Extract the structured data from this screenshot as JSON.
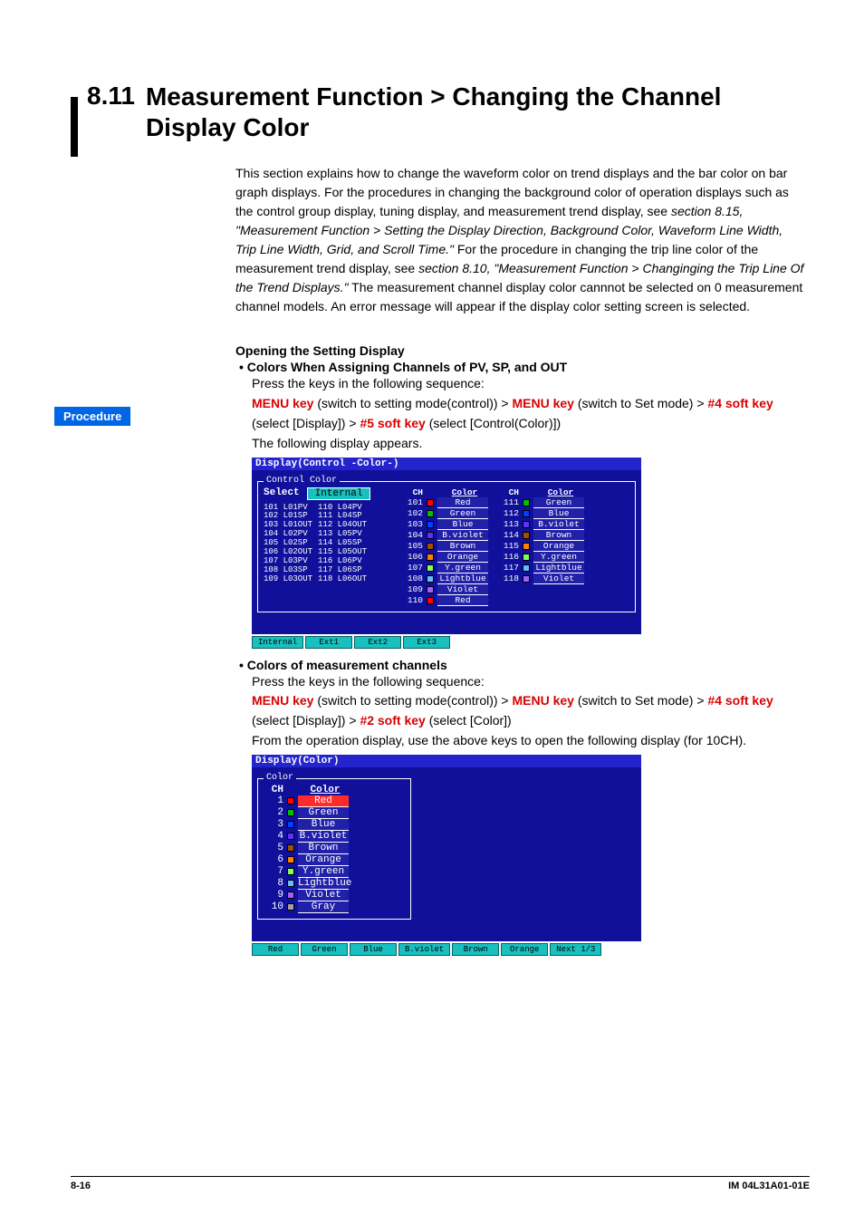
{
  "section_number": "8.11",
  "section_title": "Measurement Function > Changing the Channel Display Color",
  "intro_1": "This section explains how to change the waveform color on trend displays and the bar color on bar graph displays.  For the procedures in changing the background color of operation displays such as the control group display, tuning display, and measurement trend display, see ",
  "intro_ref1": "section 8.15, \"Measurement Function > Setting the Display Direction, Background Color, Waveform Line Width, Trip Line Width, Grid, and Scroll Time.\"",
  "intro_2": "  For the procedure in changing the trip line color of the measurement trend display, see ",
  "intro_ref2": "section 8.10, \"Measurement Function > Changinging the Trip Line Of the Trend Displays.\"",
  "intro_3": "  The measurement channel display color cannnot be selected on 0 measurement channel models.  An error message will appear if the display color setting screen is selected.",
  "procedure_label": "Procedure",
  "open_heading": "Opening the Setting Display",
  "bullet1_title": "Colors When Assigning Channels of PV, SP, and OUT",
  "press_line": "Press the keys in the following sequence:",
  "menu_key": "MENU key",
  "k4": "#4 soft key",
  "k5": "#5 soft key",
  "k2": "#2 soft key",
  "seq1_a": " (switch to setting mode(control)) > ",
  "seq1_b": " (switch to Set mode) > ",
  "seq1_c": " (select [Display]) > ",
  "seq1_d": " (select [Control(Color)])",
  "following_display": "The following display appears.",
  "scr1_title": "Display(Control -Color-)",
  "scr1_group": "Control Color",
  "scr1_select_label": "Select",
  "scr1_select_value": "Internal",
  "scr1_left_list": [
    "101 L01PV",
    "102 L01SP",
    "103 L01OUT",
    "104 L02PV",
    "105 L02SP",
    "106 L02OUT",
    "107 L03PV",
    "108 L03SP",
    "109 L03OUT"
  ],
  "scr1_right_list": [
    "110 L04PV",
    "111 L04SP",
    "112 L04OUT",
    "113 L05PV",
    "114 L05SP",
    "115 L05OUT",
    "116 L06PV",
    "117 L06SP",
    "118 L06OUT"
  ],
  "ch_header": "CH",
  "color_header": "Color",
  "scr1_colA": [
    {
      "ch": "101",
      "sw": "#ff0000",
      "name": "Red"
    },
    {
      "ch": "102",
      "sw": "#00c000",
      "name": "Green"
    },
    {
      "ch": "103",
      "sw": "#0040ff",
      "name": "Blue"
    },
    {
      "ch": "104",
      "sw": "#6030ff",
      "name": "B.violet"
    },
    {
      "ch": "105",
      "sw": "#a05000",
      "name": "Brown"
    },
    {
      "ch": "106",
      "sw": "#ff8000",
      "name": "Orange"
    },
    {
      "ch": "107",
      "sw": "#80ff60",
      "name": "Y.green"
    },
    {
      "ch": "108",
      "sw": "#60c0ff",
      "name": "Lightblue"
    },
    {
      "ch": "109",
      "sw": "#a060ff",
      "name": "Violet"
    },
    {
      "ch": "110",
      "sw": "#ff0000",
      "name": "Red"
    }
  ],
  "scr1_colB": [
    {
      "ch": "111",
      "sw": "#00c000",
      "name": "Green"
    },
    {
      "ch": "112",
      "sw": "#0040ff",
      "name": "Blue"
    },
    {
      "ch": "113",
      "sw": "#6030ff",
      "name": "B.violet"
    },
    {
      "ch": "114",
      "sw": "#a05000",
      "name": "Brown"
    },
    {
      "ch": "115",
      "sw": "#ff8000",
      "name": "Orange"
    },
    {
      "ch": "116",
      "sw": "#80ff60",
      "name": "Y.green"
    },
    {
      "ch": "117",
      "sw": "#60c0ff",
      "name": "Lightblue"
    },
    {
      "ch": "118",
      "sw": "#a060ff",
      "name": "Violet"
    }
  ],
  "scr1_softkeys": [
    "Internal",
    "Ext1",
    "Ext2",
    "Ext3"
  ],
  "bullet2_title": "Colors of measurement channels",
  "seq2_d": " (select [Color])",
  "from_op_line": "From the operation display, use the above keys to open the following display (for 10CH).",
  "scr2_title": "Display(Color)",
  "scr2_group": "Color",
  "scr2_rows": [
    {
      "ch": "1",
      "sw": "#ff0000",
      "name": "Red",
      "sel": true
    },
    {
      "ch": "2",
      "sw": "#00c000",
      "name": "Green"
    },
    {
      "ch": "3",
      "sw": "#0040ff",
      "name": "Blue"
    },
    {
      "ch": "4",
      "sw": "#6030ff",
      "name": "B.violet"
    },
    {
      "ch": "5",
      "sw": "#a05000",
      "name": "Brown"
    },
    {
      "ch": "6",
      "sw": "#ff8000",
      "name": "Orange"
    },
    {
      "ch": "7",
      "sw": "#80ff60",
      "name": "Y.green"
    },
    {
      "ch": "8",
      "sw": "#60c0ff",
      "name": "Lightblue"
    },
    {
      "ch": "9",
      "sw": "#a060ff",
      "name": "Violet"
    },
    {
      "ch": "10",
      "sw": "#a0a0a0",
      "name": "Gray"
    }
  ],
  "scr2_softkeys": [
    "Red",
    "Green",
    "Blue",
    "B.violet",
    "Brown",
    "Orange",
    "Next 1/3"
  ],
  "page_num": "8-16",
  "doc_id": "IM 04L31A01-01E"
}
